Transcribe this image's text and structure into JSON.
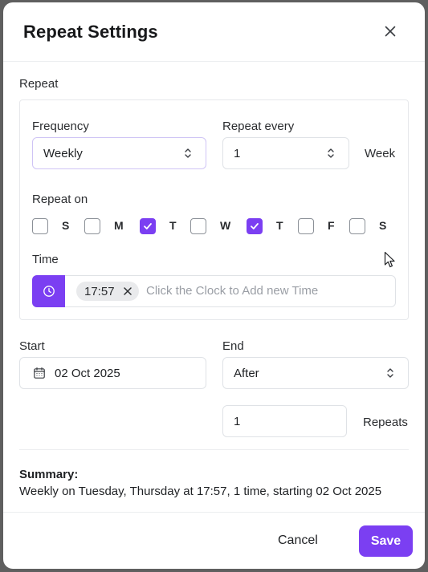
{
  "dialog": {
    "title": "Repeat Settings"
  },
  "repeat": {
    "section_label": "Repeat",
    "frequency": {
      "label": "Frequency",
      "value": "Weekly"
    },
    "repeat_every": {
      "label": "Repeat every",
      "value": "1",
      "unit": "Week"
    },
    "repeat_on": {
      "label": "Repeat on",
      "days": [
        {
          "letter": "S",
          "checked": false
        },
        {
          "letter": "M",
          "checked": false
        },
        {
          "letter": "T",
          "checked": true
        },
        {
          "letter": "W",
          "checked": false
        },
        {
          "letter": "T",
          "checked": true
        },
        {
          "letter": "F",
          "checked": false
        },
        {
          "letter": "S",
          "checked": false
        }
      ]
    },
    "time": {
      "label": "Time",
      "chips": [
        "17:57"
      ],
      "placeholder": "Click the Clock to Add new Time"
    }
  },
  "start": {
    "label": "Start",
    "value": "02 Oct 2025"
  },
  "end": {
    "label": "End",
    "value": "After",
    "count": "1",
    "count_unit": "Repeats"
  },
  "summary": {
    "label": "Summary:",
    "text": "Weekly on Tuesday, Thursday at 17:57, 1 time, starting 02 Oct 2025"
  },
  "footer": {
    "cancel_label": "Cancel",
    "save_label": "Save"
  },
  "colors": {
    "accent": "#7b3ff2",
    "overlay": "#5f5f5f"
  },
  "icons": {
    "close": "close-icon",
    "chevron": "chevron-up-down-icon",
    "clock": "clock-icon",
    "calendar": "calendar-icon",
    "remove": "remove-chip-icon",
    "check": "check-icon",
    "cursor": "mouse-pointer-icon"
  }
}
